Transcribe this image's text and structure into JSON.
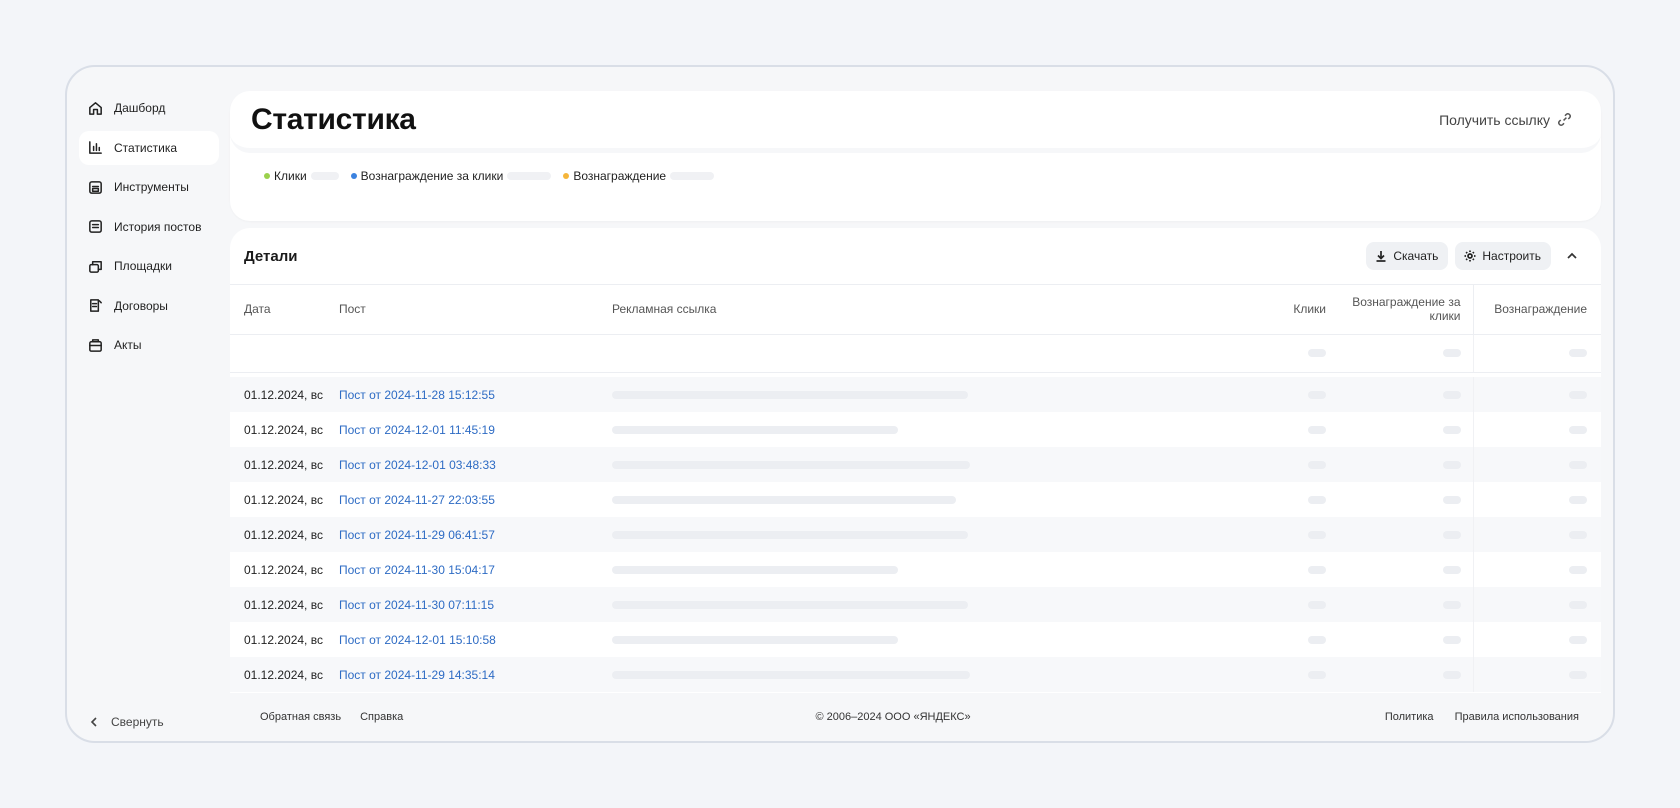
{
  "sidebar": {
    "items": [
      {
        "label": "Дашборд",
        "icon": "home-icon"
      },
      {
        "label": "Статистика",
        "icon": "chart-icon",
        "active": true
      },
      {
        "label": "Инструменты",
        "icon": "tools-icon"
      },
      {
        "label": "История постов",
        "icon": "posts-history-icon"
      },
      {
        "label": "Площадки",
        "icon": "platforms-icon"
      },
      {
        "label": "Договоры",
        "icon": "contracts-icon"
      },
      {
        "label": "Акты",
        "icon": "acts-icon"
      }
    ],
    "collapse_label": "Свернуть"
  },
  "stats": {
    "title": "Статистика",
    "get_link_label": "Получить ссылку",
    "legend": [
      {
        "label": "Клики",
        "color": "#9bd14c"
      },
      {
        "label": "Вознаграждение за клики",
        "color": "#3b82e0"
      },
      {
        "label": "Вознаграждение",
        "color": "#f5b53a"
      }
    ]
  },
  "details": {
    "title": "Детали",
    "download_label": "Скачать",
    "settings_label": "Настроить",
    "columns": {
      "date": "Дата",
      "post": "Пост",
      "ad_link": "Рекламная ссылка",
      "clicks": "Клики",
      "reward_clicks": "Вознаграждение за клики",
      "reward": "Вознаграждение"
    },
    "rows": [
      {
        "date": "01.12.2024, вс",
        "post": "Пост от 2024-11-28 15:12:55"
      },
      {
        "date": "01.12.2024, вс",
        "post": "Пост от 2024-12-01 11:45:19"
      },
      {
        "date": "01.12.2024, вс",
        "post": "Пост от 2024-12-01 03:48:33"
      },
      {
        "date": "01.12.2024, вс",
        "post": "Пост от 2024-11-27 22:03:55"
      },
      {
        "date": "01.12.2024, вс",
        "post": "Пост от 2024-11-29 06:41:57"
      },
      {
        "date": "01.12.2024, вс",
        "post": "Пост от 2024-11-30 15:04:17"
      },
      {
        "date": "01.12.2024, вс",
        "post": "Пост от 2024-11-30 07:11:15"
      },
      {
        "date": "01.12.2024, вс",
        "post": "Пост от 2024-12-01 15:10:58"
      },
      {
        "date": "01.12.2024, вс",
        "post": "Пост от 2024-11-29 14:35:14"
      }
    ]
  },
  "footer": {
    "feedback": "Обратная связь",
    "help": "Справка",
    "copyright": "© 2006–2024  ООО «ЯНДЕКС»",
    "policy": "Политика",
    "terms": "Правила использования"
  }
}
